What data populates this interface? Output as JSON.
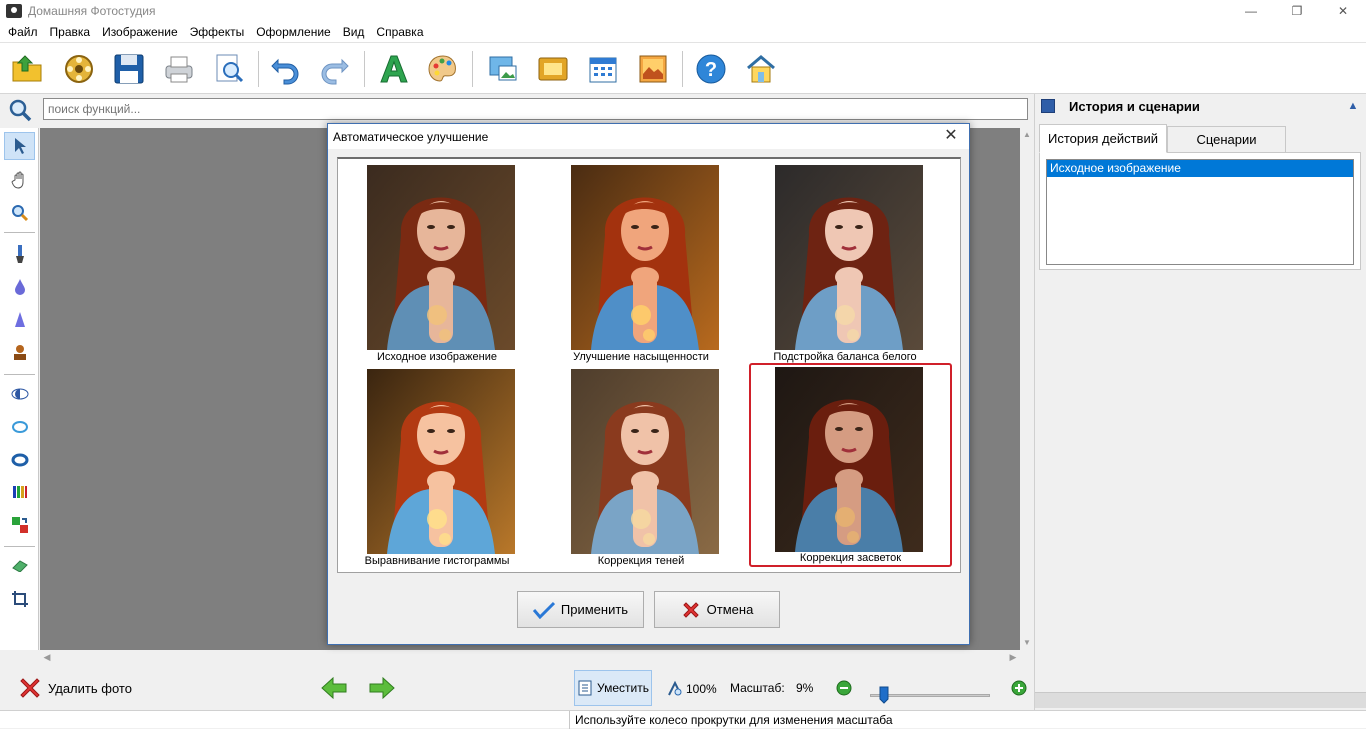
{
  "window": {
    "title": "Домашняя Фотостудия",
    "controls": {
      "minimize": "—",
      "restore": "❐",
      "close": "✕"
    }
  },
  "menu": [
    "Файл",
    "Правка",
    "Изображение",
    "Эффекты",
    "Оформление",
    "Вид",
    "Справка"
  ],
  "toolbar": {
    "icons": [
      "open-folder-icon",
      "film-reel-icon",
      "save-disk-icon",
      "printer-icon",
      "print-preview-icon",
      "undo-icon",
      "redo-icon",
      "text-icon",
      "palette-icon",
      "picture-in-picture-icon",
      "frame-icon",
      "calendar-icon",
      "photo-collage-icon",
      "help-icon",
      "home-icon"
    ]
  },
  "search": {
    "placeholder": "поиск функций..."
  },
  "left_tools": [
    "cursor-icon",
    "hand-icon",
    "zoom-icon",
    "brush-icon",
    "drop-icon",
    "cone-icon",
    "stamp-icon",
    "eye-icon",
    "ring-icon",
    "ring-bold-icon",
    "color-levels-icon",
    "color-swap-icon",
    "eraser-icon",
    "crop-icon"
  ],
  "right_panel": {
    "title": "История и сценарии",
    "tabs": [
      {
        "label": "История действий",
        "active": true
      },
      {
        "label": "Сценарии",
        "active": false
      }
    ],
    "history": [
      "Исходное изображение"
    ]
  },
  "dialog": {
    "title": "Автоматическое улучшение",
    "close": "✕",
    "thumbnails": [
      {
        "caption": "Исходное изображение",
        "variant": "original",
        "selected": false
      },
      {
        "caption": "Улучшение насыщенности",
        "variant": "saturated",
        "selected": false
      },
      {
        "caption": "Подстройка баланса белого",
        "variant": "whitebalance",
        "selected": false
      },
      {
        "caption": "Выравнивание гистограммы",
        "variant": "histogram",
        "selected": false
      },
      {
        "caption": "Коррекция теней",
        "variant": "shadows",
        "selected": false
      },
      {
        "caption": "Коррекция засветок",
        "variant": "highlights",
        "selected": true
      }
    ],
    "apply_label": "Применить",
    "cancel_label": "Отмена"
  },
  "bottom": {
    "delete_label": "Удалить фото",
    "fit_label": "Уместить",
    "zoom100_label": "100%",
    "scale_label": "Масштаб:",
    "scale_value": "9%",
    "zoom_slider_fraction": 0.12
  },
  "status": {
    "hint": "Используйте колесо прокрутки для изменения масштаба"
  },
  "colors": {
    "accent": "#0078d7",
    "selection_border": "#d0202a",
    "canvas_bg": "#7f7f7f"
  }
}
